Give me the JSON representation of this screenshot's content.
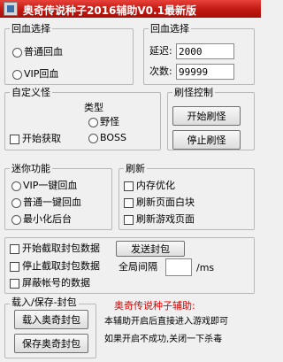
{
  "window": {
    "title": "奥奇传说种子2016辅助V0.1最新版"
  },
  "hp_recover": {
    "title": "回血选择",
    "options": [
      "普通回血",
      "VIP回血"
    ]
  },
  "hp_select": {
    "title": "回血选择",
    "delay_label": "延迟:",
    "delay_value": "2000",
    "count_label": "次数:",
    "count_value": "99999"
  },
  "custom_monster": {
    "title": "自定义怪",
    "start_fetch": "开始获取",
    "type_label": "类型",
    "types": [
      "野怪",
      "BOSS"
    ]
  },
  "farm_control": {
    "title": "刷怪控制",
    "start_button": "开始刷怪",
    "stop_button": "停止刷怪"
  },
  "mini_functions": {
    "title": "迷你功能",
    "options": [
      "VIP一键回血",
      "普通一键回血",
      "最小化后台"
    ]
  },
  "refresh": {
    "title": "刷新",
    "options": [
      "内存优化",
      "刷新页面白块",
      "刷新游戏页面"
    ]
  },
  "packets": {
    "start_capture": "开始截取封包数据",
    "stop_capture": "停止截取封包数据",
    "block_account": "屏蔽帐号的数据",
    "send_button": "发送封包",
    "interval_label": "全局间隔",
    "interval_value": "",
    "interval_unit": "/ms"
  },
  "load_save": {
    "title": "载入/保存-封包",
    "load_button": "载入奥奇封包",
    "save_button": "保存奥奇封包"
  },
  "info": {
    "heading": "奥奇传说种子辅助:",
    "line1": "本辅助开启后直接进入游戏即可",
    "line2": "如果开启不成功,关闭一下杀毒"
  },
  "colors": {
    "titlebar": "#c01810",
    "accent_text": "#e00000",
    "background": "#f0f0f0"
  }
}
